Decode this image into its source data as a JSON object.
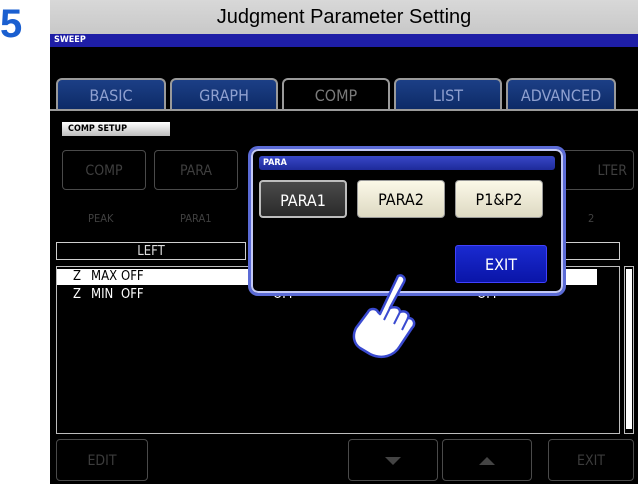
{
  "step_number": "5",
  "title": "Judgment Parameter Setting",
  "mode": "SWEEP",
  "tabs": [
    {
      "label": "BASIC",
      "active": false
    },
    {
      "label": "GRAPH",
      "active": false
    },
    {
      "label": "COMP",
      "active": true
    },
    {
      "label": "LIST",
      "active": false
    },
    {
      "label": "ADVANCED",
      "active": false
    }
  ],
  "comp_setup_label": "COMP SETUP",
  "bg_buttons": [
    "COMP",
    "PARA",
    "LTER"
  ],
  "bg_values": [
    "PEAK",
    "PARA1",
    "2"
  ],
  "column_header": {
    "left": "LEFT"
  },
  "rows": [
    {
      "param": "Z",
      "limit": "MAX",
      "left": "OFF",
      "mid": "",
      "right": ""
    },
    {
      "param": "Z",
      "limit": "MIN",
      "left": "OFF",
      "mid": "OFF",
      "right": "OFF"
    }
  ],
  "bottom_buttons": {
    "edit": "EDIT",
    "exit": "EXIT"
  },
  "popup": {
    "title": "PARA",
    "options": [
      {
        "label": "PARA1",
        "selected": true
      },
      {
        "label": "PARA2",
        "selected": false
      },
      {
        "label": "P1&P2",
        "selected": false
      }
    ],
    "exit_label": "EXIT"
  },
  "colors": {
    "accent_blue": "#1a5fd0",
    "popup_border": "#5b6bd6",
    "exit_blue": "#0a15a8"
  }
}
